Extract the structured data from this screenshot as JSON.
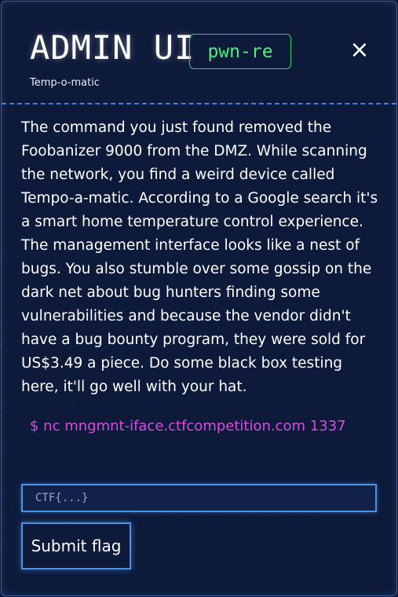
{
  "header": {
    "title": "ADMIN UI",
    "subtitle": "Temp-o-matic",
    "category_tag": "pwn-re",
    "close_icon": "×"
  },
  "challenge": {
    "description": "The command you just found removed the Foobanizer 9000 from the DMZ. While scanning the network, you find a weird device called Tempo-a-matic. According to a Google search it's a smart home temperature control experience. The management interface looks like a nest of bugs. You also stumble over some gossip on the dark net about bug hunters finding some vulnerabilities and because the vendor didn't have a bug bounty program, they were sold for US$3.49 a piece. Do some black box testing here, it'll go well with your hat.",
    "command": "$ nc mngmnt-iface.ctfcompetition.com 1337"
  },
  "form": {
    "flag_placeholder": "CTF{...}",
    "submit_label": "Submit flag"
  },
  "colors": {
    "background": "#0e1a3a",
    "accent_blue": "#4a93e6",
    "tag_green": "#4ef07e",
    "command_magenta": "#d94be0"
  }
}
